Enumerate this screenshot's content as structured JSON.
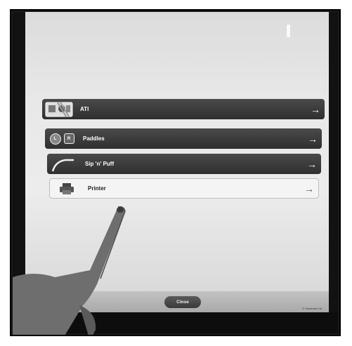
{
  "options": [
    {
      "label": "ATI",
      "icon": "ati-switch-icon"
    },
    {
      "label": "Paddles",
      "icon": "paddles-icon",
      "icon_letters": [
        "L",
        "R"
      ]
    },
    {
      "label": "Sip 'n' Puff",
      "icon": "sip-puff-tube-icon"
    },
    {
      "label": "Printer",
      "icon": "printer-icon"
    }
  ],
  "arrow_glyph": "→",
  "footer": {
    "close_label": "Close",
    "brand": "© Someone Ltd"
  },
  "colors": {
    "dark_row": "#333333",
    "light_row": "#f4f4f4",
    "footer": "#b5b5b5"
  }
}
